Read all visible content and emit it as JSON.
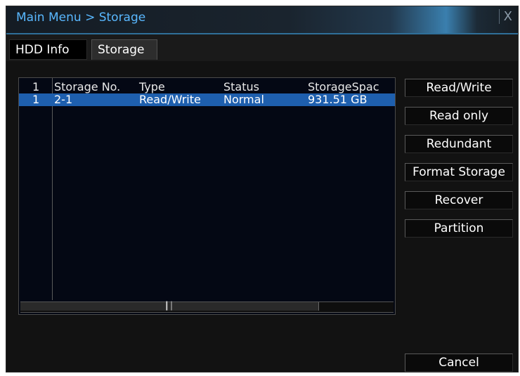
{
  "window": {
    "title": "Main Menu > Storage",
    "close_label": "X"
  },
  "tabs": [
    {
      "label": "HDD Info"
    },
    {
      "label": "Storage"
    }
  ],
  "table": {
    "headers": [
      "1",
      "Storage No.",
      "Type",
      "Status",
      "StorageSpac"
    ],
    "rows": [
      [
        "1",
        "2-1",
        "Read/Write",
        "Normal",
        "931.51 GB"
      ]
    ]
  },
  "buttons": {
    "read_write": "Read/Write",
    "read_only": "Read only",
    "redundant": "Redundant",
    "format_storage": "Format Storage",
    "recover": "Recover",
    "partition": "Partition",
    "cancel": "Cancel"
  },
  "scrollbar": {
    "grip_icon": "scroll-grip-icon"
  },
  "colors": {
    "accent": "#59b8ff",
    "selection": "#1e5fae",
    "background": "#121212"
  }
}
